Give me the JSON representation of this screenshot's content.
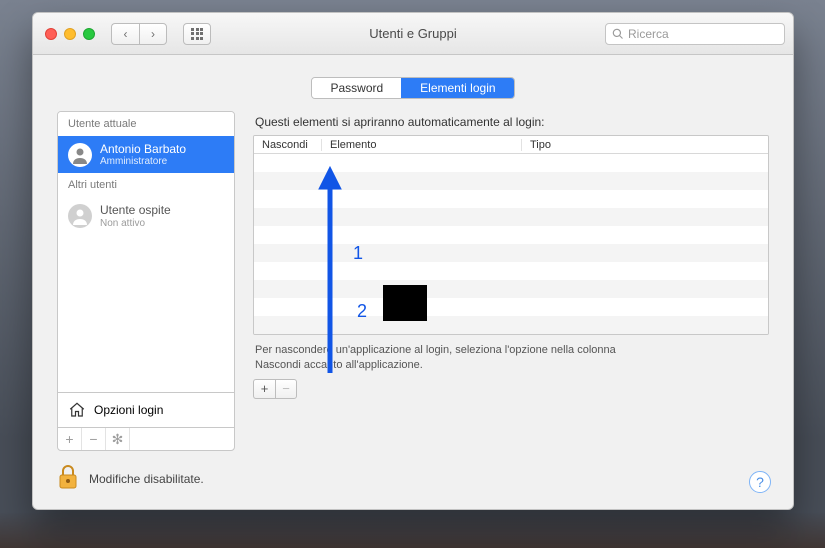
{
  "window": {
    "title": "Utenti e Gruppi"
  },
  "search": {
    "placeholder": "Ricerca"
  },
  "tabs": {
    "password": "Password",
    "login_items": "Elementi login"
  },
  "sidebar": {
    "current_header": "Utente attuale",
    "other_header": "Altri utenti",
    "current_user": {
      "name": "Antonio Barbato",
      "role": "Amministratore"
    },
    "guest": {
      "name": "Utente ospite",
      "status": "Non attivo"
    },
    "login_options": "Opzioni login"
  },
  "main": {
    "intro": "Questi elementi si apriranno automaticamente al login:",
    "columns": {
      "hide": "Nascondi",
      "item": "Elemento",
      "kind": "Tipo"
    },
    "hint": "Per nascondere un'applicazione al login, seleziona l'opzione nella colonna Nascondi accanto all'applicazione."
  },
  "footer": {
    "lock_text": "Modifiche disabilitate."
  },
  "annotations": {
    "one": "1",
    "two": "2"
  }
}
